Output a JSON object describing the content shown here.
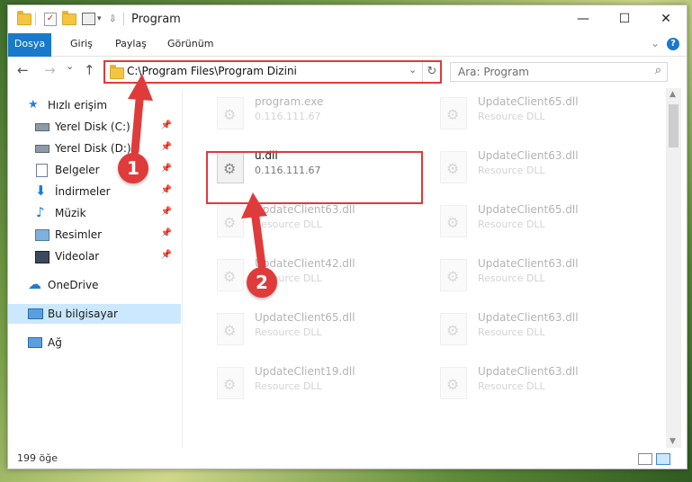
{
  "window": {
    "title": "Program",
    "minimize": "—",
    "maximize": "☐",
    "close": "✕"
  },
  "ribbon": {
    "tabs": [
      "Dosya",
      "Giriş",
      "Paylaş",
      "Görünüm"
    ],
    "help": "?"
  },
  "nav": {
    "back": "←",
    "forward": "→",
    "recent": "⌄",
    "up": "↑",
    "address": "C:\\Program Files\\Program Dizini",
    "refresh": "↻",
    "search_placeholder": "Ara: Program",
    "search_icon": "⌕"
  },
  "sidebar": {
    "items": [
      {
        "label": "Hızlı erişim",
        "icon": "star-icon"
      },
      {
        "label": "Yerel Disk (C:)",
        "icon": "drive-icon",
        "pinned": true
      },
      {
        "label": "Yerel Disk (D:)",
        "icon": "drive-icon",
        "pinned": true
      },
      {
        "label": "Belgeler",
        "icon": "documents-icon",
        "pinned": true
      },
      {
        "label": "İndirmeler",
        "icon": "download-icon",
        "pinned": true
      },
      {
        "label": "Müzik",
        "icon": "music-icon",
        "pinned": true
      },
      {
        "label": "Resimler",
        "icon": "pictures-icon",
        "pinned": true
      },
      {
        "label": "Videolar",
        "icon": "videos-icon",
        "pinned": true
      },
      {
        "label": "OneDrive",
        "icon": "cloud-icon"
      },
      {
        "label": "Bu bilgisayar",
        "icon": "computer-icon",
        "selected": true
      },
      {
        "label": "Ağ",
        "icon": "network-icon"
      }
    ]
  },
  "files": {
    "left": [
      {
        "name": "program.exe",
        "sub": "0.116.111.67",
        "faded": true
      },
      {
        "name": "u.dll",
        "sub": "0.116.111.67",
        "faded": false
      },
      {
        "name": "UpdateClient63.dll",
        "sub": "Resource DLL",
        "faded": true
      },
      {
        "name": "UpdateClient42.dll",
        "sub": "Resource DLL",
        "faded": true
      },
      {
        "name": "UpdateClient65.dll",
        "sub": "Resource DLL",
        "faded": true
      },
      {
        "name": "UpdateClient19.dll",
        "sub": "Resource DLL",
        "faded": true
      }
    ],
    "right": [
      {
        "name": "UpdateClient65.dll",
        "sub": "Resource DLL",
        "faded": true
      },
      {
        "name": "UpdateClient63.dll",
        "sub": "Resource DLL",
        "faded": true
      },
      {
        "name": "UpdateClient65.dll",
        "sub": "Resource DLL",
        "faded": true
      },
      {
        "name": "UpdateClient63.dll",
        "sub": "Resource DLL",
        "faded": true
      },
      {
        "name": "UpdateClient63.dll",
        "sub": "Resource DLL",
        "faded": true
      },
      {
        "name": "UpdateClient63.dll",
        "sub": "Resource DLL",
        "faded": true
      }
    ]
  },
  "status": {
    "count": "199 öğe"
  },
  "annotations": {
    "step1": "1",
    "step2": "2",
    "color": "#df3b3b"
  }
}
